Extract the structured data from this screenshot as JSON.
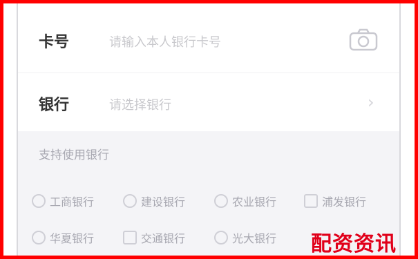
{
  "form": {
    "card_number": {
      "label": "卡号",
      "placeholder": "请输入本人银行卡号"
    },
    "bank": {
      "label": "银行",
      "placeholder": "请选择银行"
    }
  },
  "icons": {
    "camera": "camera-icon",
    "chevron": "chevron-right-icon"
  },
  "chevron_glyph": "›",
  "support": {
    "title": "支持使用银行",
    "banks_row1": [
      {
        "name": "工商银行"
      },
      {
        "name": "建设银行"
      },
      {
        "name": "农业银行"
      },
      {
        "name": "浦发银行"
      }
    ],
    "banks_row2": [
      {
        "name": "华夏银行"
      },
      {
        "name": "交通银行"
      },
      {
        "name": "光大银行"
      }
    ]
  },
  "watermark": "配资资讯",
  "colors": {
    "frame": "#ff0000",
    "watermark": "#e1001a",
    "panel": "#f4f4f7"
  }
}
